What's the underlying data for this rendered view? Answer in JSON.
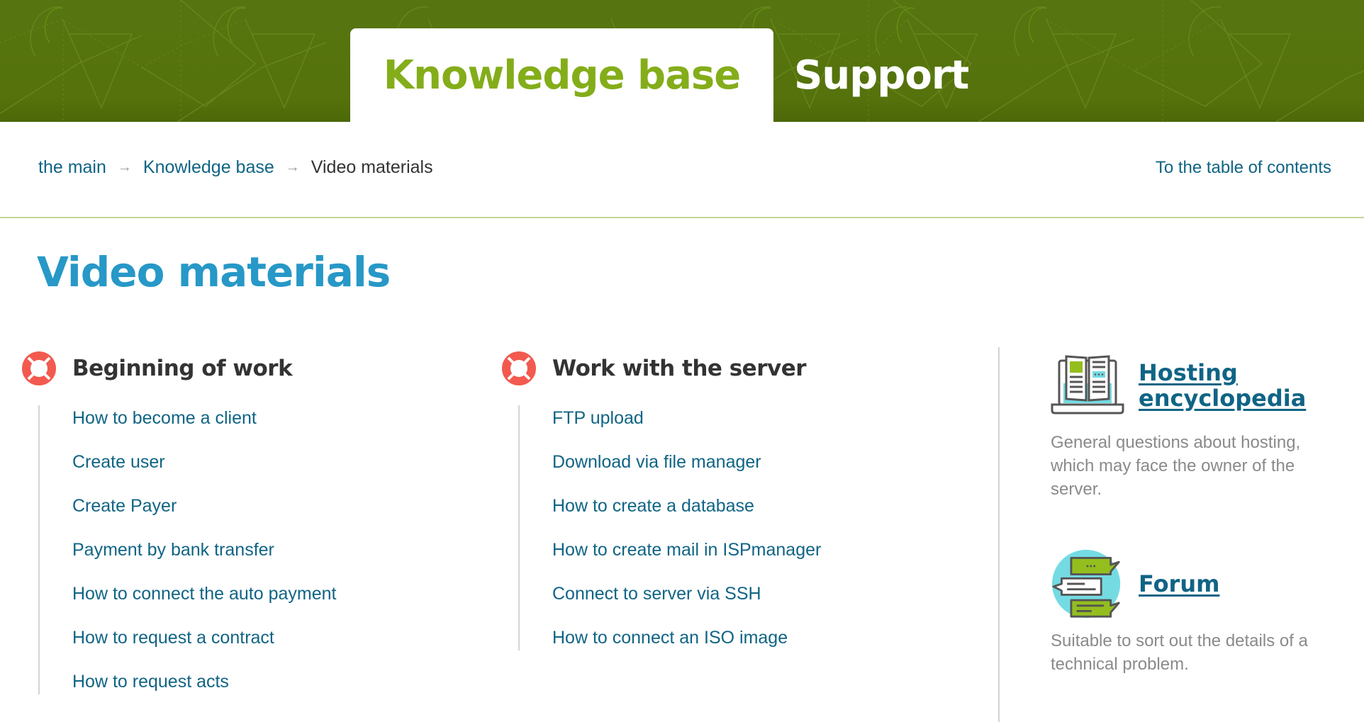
{
  "header": {
    "tabs": [
      {
        "label": "Knowledge base",
        "active": true
      },
      {
        "label": "Support",
        "active": false
      }
    ]
  },
  "breadcrumb": {
    "items": [
      {
        "label": "the main",
        "link": true
      },
      {
        "label": "Knowledge base",
        "link": true
      },
      {
        "label": "Video materials",
        "link": false
      }
    ],
    "separator_icon": "arrow-right-icon",
    "toc_link": "To the table of contents"
  },
  "page": {
    "title": "Video materials"
  },
  "sections": [
    {
      "icon": "lifebuoy-icon",
      "title": "Beginning of work",
      "links": [
        "How to become a client",
        "Create user",
        "Create Payer",
        "Payment by bank transfer",
        "How to connect the auto payment",
        "How to request a contract",
        "How to request acts"
      ]
    },
    {
      "icon": "lifebuoy-icon",
      "title": "Work with the server",
      "links": [
        "FTP upload",
        "Download via file manager",
        "How to create a database",
        "How to create mail in ISPmanager",
        "Connect to server via SSH",
        "How to connect an ISO image"
      ]
    }
  ],
  "aside": [
    {
      "icon": "encyclopedia-laptop-icon",
      "title": "Hosting encyclopedia",
      "description": "General questions about hosting, which may face the owner of the server."
    },
    {
      "icon": "forum-chat-icon",
      "title": "Forum",
      "description": "Suitable to sort out the details of a technical problem."
    }
  ],
  "colors": {
    "header_green": "#567510",
    "active_tab_text": "#84ad1a",
    "link_blue": "#106485",
    "title_blue": "#2798c7",
    "lifebuoy_red": "#f25a4f",
    "muted_gray": "#8a8a8a"
  }
}
